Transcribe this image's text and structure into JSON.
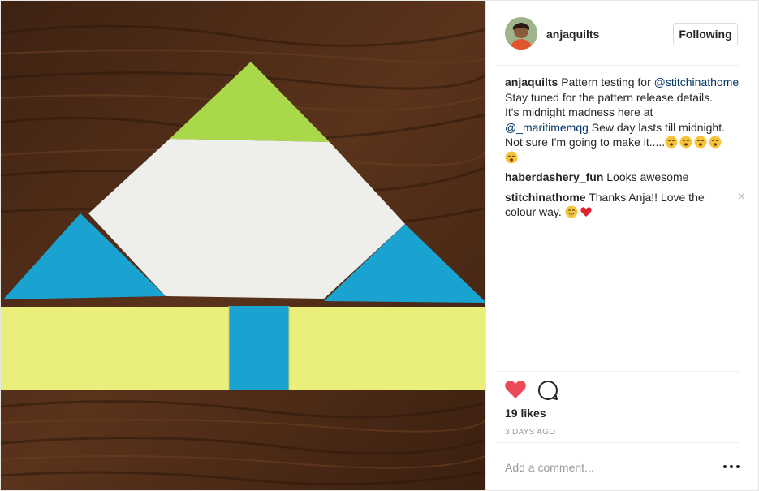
{
  "post": {
    "username": "anjaquilts",
    "follow_label": "Following",
    "caption": {
      "author": "anjaquilts",
      "lines": [
        [
          "Pattern testing for ",
          "@stitchinathome"
        ],
        [
          "Stay tuned for the pattern release details."
        ],
        [
          "It's midnight madness here at"
        ],
        [
          "@_maritimemqg",
          " Sew day lasts till midnight."
        ],
        [
          "Not sure I'm going to make it....."
        ]
      ],
      "emoji": "sleepy-face-emoji"
    },
    "comments": [
      {
        "author": "haberdashery_fun",
        "text": "Looks awesome",
        "emoji": []
      },
      {
        "author": "stitchinathome",
        "text": "Thanks Anja!! Love the colour way.",
        "emoji": [
          "grin-emoji",
          "red-heart-emoji"
        ]
      }
    ],
    "likes": "19 likes",
    "timestamp": "3 DAYS AGO",
    "add_comment_placeholder": "Add a comment...",
    "icons": {
      "heart": "heart-icon",
      "comment": "comment-bubble-icon",
      "more": "more-options-icon",
      "close": "close-icon"
    },
    "colors": {
      "heart": "#ed4956",
      "mention": "#003569",
      "text": "#262626",
      "muted": "#999999",
      "quilt_green": "#a9d84a",
      "quilt_blue": "#1aa3d1",
      "quilt_yellow": "#e9ef7a",
      "quilt_white": "#eeeeea",
      "wood": "#4a2a17"
    }
  }
}
